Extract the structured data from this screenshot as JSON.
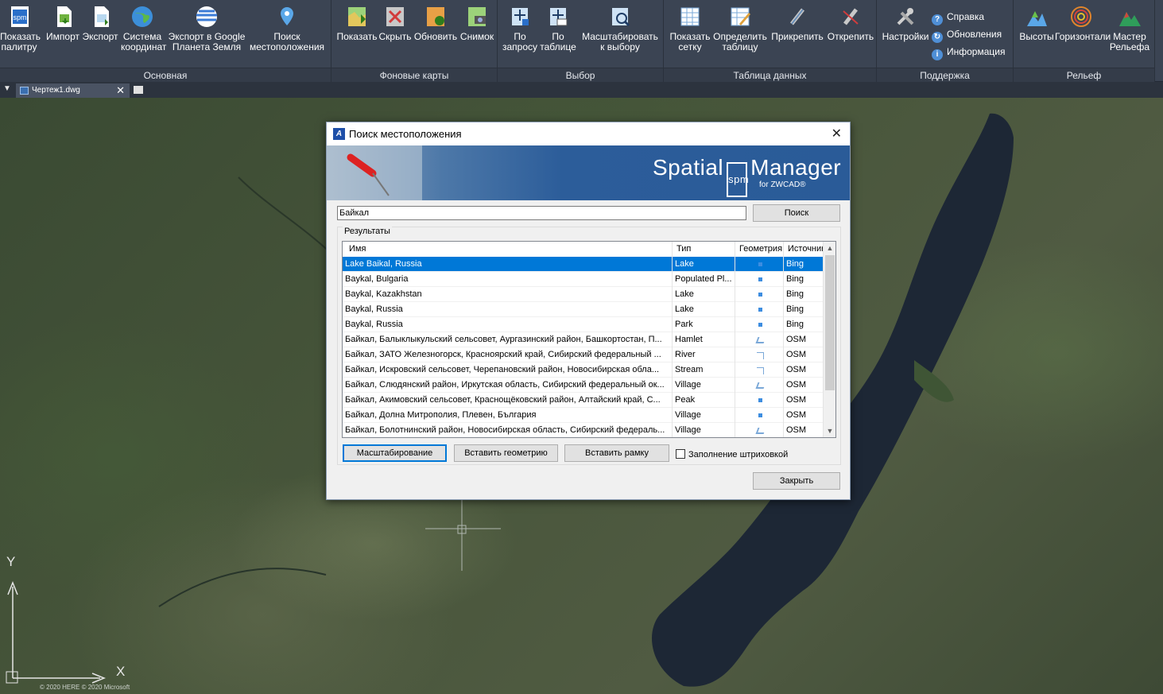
{
  "ribbon": {
    "panels": {
      "main": {
        "title": "Основная",
        "buttons": {
          "palette": "Показать\nпалитру",
          "import": "Импорт",
          "export": "Экспорт",
          "crs": "Система\nкоординат",
          "google": "Экспорт в Google\nПланета Земля",
          "locate": "Поиск\nместоположения"
        }
      },
      "background": {
        "title": "Фоновые карты",
        "buttons": {
          "show": "Показать",
          "hide": "Скрыть",
          "refresh": "Обновить",
          "snapshot": "Снимок"
        }
      },
      "select": {
        "title": "Выбор",
        "buttons": {
          "by_query": "По\nзапросу",
          "by_table": "По\nтаблице",
          "zoom_sel": "Масштабировать\nк выбору"
        }
      },
      "datatable": {
        "title": "Таблица данных",
        "buttons": {
          "show_grid": "Показать\nсетку",
          "define": "Определить\nтаблицу",
          "attach": "Прикрепить",
          "detach": "Открепить"
        }
      },
      "support": {
        "title": "Поддержка",
        "buttons": {
          "settings": "Настройки",
          "help": "Справка",
          "updates": "Обновления",
          "info": "Информация"
        }
      },
      "relief": {
        "title": "Рельеф",
        "buttons": {
          "heights": "Высоты",
          "contours": "Горизонтали",
          "wizard": "Мастер\nРельефа"
        }
      }
    }
  },
  "tabs": {
    "file": "Чертеж1.dwg"
  },
  "map": {
    "copyright": "© 2020 HERE © 2020 Microsoft",
    "axis_x": "X",
    "axis_y": "Y"
  },
  "dialog": {
    "title": "Поиск местоположения",
    "brand": {
      "name1": "Spatial",
      "mark": "spm",
      "name2": "Manager",
      "sub": "for ZWCAD®"
    },
    "search_value": "Байкал",
    "search_button": "Поиск",
    "results_label": "Результаты",
    "columns": {
      "name": "Имя",
      "type": "Тип",
      "geometry": "Геометрия",
      "source": "Источник"
    },
    "results": [
      {
        "name": "Lake Baikal, Russia",
        "type": "Lake",
        "geom": "point",
        "source": "Bing"
      },
      {
        "name": "Baykal, Bulgaria",
        "type": "Populated Pl...",
        "geom": "point",
        "source": "Bing"
      },
      {
        "name": "Baykal, Kazakhstan",
        "type": "Lake",
        "geom": "point",
        "source": "Bing"
      },
      {
        "name": "Baykal, Russia",
        "type": "Lake",
        "geom": "point",
        "source": "Bing"
      },
      {
        "name": "Baykal, Russia",
        "type": "Park",
        "geom": "point",
        "source": "Bing"
      },
      {
        "name": "Байкал, Балыклыкульский сельсовет, Аургазинский район, Башкортостан, П...",
        "type": "Hamlet",
        "geom": "polygon",
        "source": "OSM"
      },
      {
        "name": "Байкал, ЗАТО Железногорск, Красноярский край, Сибирский федеральный ...",
        "type": "River",
        "geom": "line",
        "source": "OSM"
      },
      {
        "name": "Байкал, Искровский сельсовет, Черепановский район, Новосибирская обла...",
        "type": "Stream",
        "geom": "line",
        "source": "OSM"
      },
      {
        "name": "Байкал, Слюдянский район, Иркутская область, Сибирский федеральный ок...",
        "type": "Village",
        "geom": "polygon",
        "source": "OSM"
      },
      {
        "name": "Байкал, Акимовский сельсовет, Краснощёковский район, Алтайский край, С...",
        "type": "Peak",
        "geom": "point",
        "source": "OSM"
      },
      {
        "name": "Байкал, Долна Митрополия, Плевен, България",
        "type": "Village",
        "geom": "point",
        "source": "OSM"
      },
      {
        "name": "Байкал, Болотнинский район, Новосибирская область, Сибирский федераль...",
        "type": "Village",
        "geom": "polygon",
        "source": "OSM"
      }
    ],
    "buttons": {
      "zoom": "Масштабирование",
      "insert_geom": "Вставить геометрию",
      "insert_frame": "Вставить рамку",
      "close": "Закрыть"
    },
    "hatch_fill": "Заполнение штриховкой"
  }
}
